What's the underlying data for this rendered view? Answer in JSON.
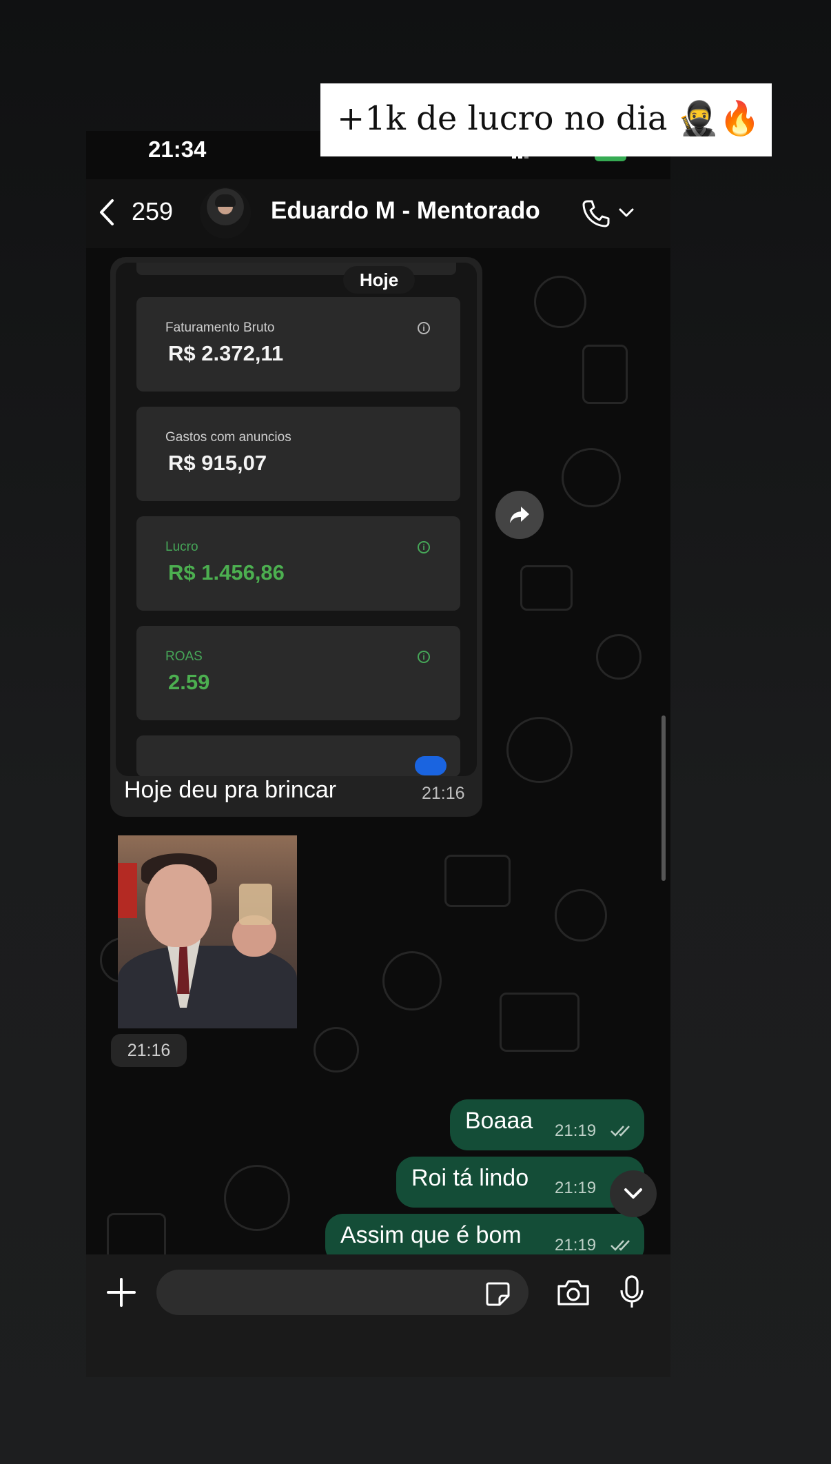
{
  "overlay": {
    "caption": "+1k de lucro no dia 🥷🔥"
  },
  "status": {
    "time": "21:34"
  },
  "header": {
    "back_count": "259",
    "contact_name": "Eduardo M - Mentorado"
  },
  "date_pill": "Hoje",
  "dashboard": {
    "cards": [
      {
        "label": "Faturamento Bruto",
        "value": "R$ 2.372,11"
      },
      {
        "label": "Gastos com anuncios",
        "value": "R$ 915,07"
      },
      {
        "label": "Lucro",
        "value": "R$ 1.456,86"
      },
      {
        "label": "ROAS",
        "value": "2.59"
      }
    ],
    "accent_green": "#4caf50"
  },
  "messages": {
    "incoming_caption": {
      "text": "Hoje deu pra brincar",
      "time": "21:16"
    },
    "photo": {
      "time": "21:16"
    },
    "outgoing": [
      {
        "text": "Boaaa",
        "time": "21:19"
      },
      {
        "text": "Roi tá lindo",
        "time": "21:19"
      },
      {
        "text": "Assim que é bom",
        "time": "21:19"
      }
    ],
    "outgoing_color": "#144d37"
  },
  "icons": {
    "back": "chevron-left-icon",
    "call": "phone-icon",
    "forward": "forward-arrow-icon",
    "scroll_down": "chevron-down-icon",
    "attach": "plus-icon",
    "sticker": "sticker-icon",
    "camera": "camera-icon",
    "mic": "microphone-icon"
  }
}
